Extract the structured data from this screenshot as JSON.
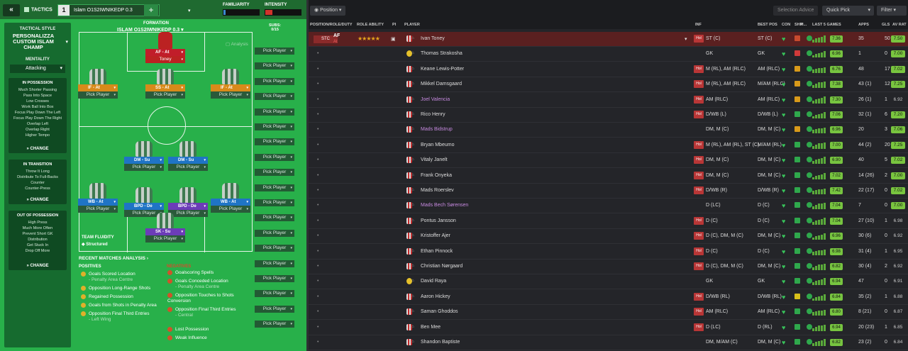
{
  "top": {
    "tab_label": "TACTICS",
    "tab_number": "1",
    "tactic_name": "Islam O1S2IWNIKEDP 0.3",
    "familiarity_label": "FAMILIARITY",
    "intensity_label": "INTENSITY",
    "familiarity_level": 0.05,
    "intensity_level": 0.2
  },
  "sidebar": {
    "style_label": "TACTICAL STYLE",
    "style_name": "PERSONALIZZA CUSTOM ISLAM CHAMP",
    "mentality_label": "MENTALITY",
    "mentality_value": "Attacking",
    "in_possession": {
      "title": "IN POSSESSION",
      "items": [
        "Much Shorter Passing",
        "Pass Into Space",
        "Low Crosses",
        "Work Ball Into Box",
        "Focus Play Down The Left",
        "Focus Play Down The Right",
        "Overlap Left",
        "Overlap Right",
        "Higher Tempo"
      ]
    },
    "in_transition": {
      "title": "IN TRANSITION",
      "items": [
        "Throw It Long",
        "Distribute To Full-Backs",
        "Counter",
        "Counter-Press"
      ]
    },
    "out_of_possession": {
      "title": "OUT OF POSSESSION",
      "items": [
        "High Press",
        "Much More Often",
        "Prevent Short GK",
        "Distribution",
        "Get Stuck In",
        "Drop Off More"
      ]
    },
    "change_label": "CHANGE"
  },
  "formation": {
    "label": "FORMATION",
    "name": "ISLAM O1S2IWNIKEDP 0.3",
    "subs_label": "SUBS:",
    "subs_count": "0/15",
    "analysis_label": "Analysis",
    "pick_label": "Pick Player",
    "fluidity_label": "TEAM FLUIDITY",
    "fluidity_value": "Structured",
    "slots": [
      {
        "role": "AF - At",
        "player": "Toney"
      },
      {
        "role": "IF - At",
        "player": "Pick Player"
      },
      {
        "role": "SS - At",
        "player": "Pick Player"
      },
      {
        "role": "IF - At",
        "player": "Pick Player"
      },
      {
        "role": "DM - Su",
        "player": "Pick Player"
      },
      {
        "role": "DM - Su",
        "player": "Pick Player"
      },
      {
        "role": "WB - At",
        "player": "Pick Player"
      },
      {
        "role": "BPD - De",
        "player": "Pick Player"
      },
      {
        "role": "BPD - De",
        "player": "Pick Player"
      },
      {
        "role": "WB - At",
        "player": "Pick Player"
      },
      {
        "role": "SK - Su",
        "player": "Pick Player"
      }
    ]
  },
  "analysis": {
    "title": "RECENT MATCHES ANALYSIS",
    "positives_label": "POSITIVES",
    "negatives_label": "NEGATIVES",
    "positives": [
      {
        "text": "Goals Scored Location",
        "sub": "- Penalty Area Centre"
      },
      {
        "text": "Opposition Long-Range Shots",
        "sub": ""
      },
      {
        "text": "Regained Possession",
        "sub": ""
      },
      {
        "text": "Goals from Shots in Penalty Area",
        "sub": ""
      },
      {
        "text": "Opposition Final Third Entries",
        "sub": "- Left Wing"
      }
    ],
    "negatives": [
      {
        "text": "Goalscoring Spells",
        "sub": ""
      },
      {
        "text": "Goals Conceded Location",
        "sub": "- Penalty Area Centre"
      },
      {
        "text": "Opposition Touches to Shots Conversion",
        "sub": ""
      },
      {
        "text": "Opposition Final Third Entries",
        "sub": "- Central"
      },
      {
        "text": "Lost Possession",
        "sub": ""
      },
      {
        "text": "Weak Influence",
        "sub": ""
      }
    ]
  },
  "right": {
    "position_btn": "Position",
    "selection_advice": "Selection Advice",
    "quick_pick": "Quick Pick",
    "filter": "Filter",
    "headers": [
      "POSITION/ROLE/DUTY",
      "ROLE ABILITY",
      "PI",
      "PLAYER",
      "INF",
      "BEST POS",
      "CON",
      "SHP",
      "M...",
      "LAST 5 GAMES",
      "APPS",
      "GLS",
      "AV RAT"
    ],
    "selected": {
      "pos": "STC",
      "role": "AF",
      "duty": "At"
    },
    "players": [
      {
        "name": "Ivan Toney",
        "inf": "Hol",
        "pos": "ST (C)",
        "best": "ST (C)",
        "rat": "7.36",
        "apps": "35",
        "gls": "50",
        "av": "7.50",
        "loan": false,
        "gk": false,
        "shp": "#c74a2e"
      },
      {
        "name": "Thomas Strakosha",
        "inf": "",
        "pos": "GK",
        "best": "GK",
        "rat": "6.96",
        "apps": "1",
        "gls": "0",
        "av": "7.00",
        "loan": false,
        "gk": true,
        "shp": "#d03a3a"
      },
      {
        "name": "Keane Lewis-Potter",
        "inf": "Hol",
        "pos": "M (RL), AM (RLC)",
        "best": "AM (RLC)",
        "rat": "6.76",
        "apps": "48",
        "gls": "17",
        "av": "7.02",
        "loan": false,
        "gk": false,
        "shp": "#d89a1a"
      },
      {
        "name": "Mikkel Damsgaard",
        "inf": "Hol",
        "pos": "M (RL), AM (RLC)",
        "best": "M/AM (RLC)",
        "rat": "7.38",
        "apps": "43 (1)",
        "gls": "12",
        "av": "7.25",
        "loan": false,
        "gk": false,
        "shp": "#d89a1a"
      },
      {
        "name": "Joel Valencia",
        "inf": "Hol",
        "pos": "AM (RLC)",
        "best": "AM (RLC)",
        "rat": "7.30",
        "apps": "26 (1)",
        "gls": "1",
        "av": "6.92",
        "loan": true,
        "gk": false,
        "shp": "#d89a1a"
      },
      {
        "name": "Rico Henry",
        "inf": "Hol",
        "pos": "D/WB (L)",
        "best": "D/WB (L)",
        "rat": "7.06",
        "apps": "32 (1)",
        "gls": "6",
        "av": "7.20",
        "loan": false,
        "gk": false,
        "shp": "#2fa84c"
      },
      {
        "name": "Mads Bidstrup",
        "inf": "",
        "pos": "DM, M (C)",
        "best": "DM, M (C)",
        "rat": "6.96",
        "apps": "20",
        "gls": "3",
        "av": "7.06",
        "loan": true,
        "gk": false,
        "shp": "#d89a1a"
      },
      {
        "name": "Bryan Mbeumo",
        "inf": "Hol",
        "pos": "M (RL), AM (RL), ST (C)",
        "best": "M/AM (RL)",
        "rat": "7.00",
        "apps": "44 (2)",
        "gls": "20",
        "av": "7.25",
        "loan": false,
        "gk": false,
        "shp": "#2fa84c"
      },
      {
        "name": "Vitaly Janelt",
        "inf": "Hol",
        "pos": "DM, M (C)",
        "best": "DM, M (C)",
        "rat": "6.90",
        "apps": "40",
        "gls": "5",
        "av": "7.02",
        "loan": false,
        "gk": false,
        "shp": "#2fa84c"
      },
      {
        "name": "Frank Onyeka",
        "inf": "Hol",
        "pos": "DM, M (C)",
        "best": "DM, M (C)",
        "rat": "7.02",
        "apps": "14 (26)",
        "gls": "2",
        "av": "7.00",
        "loan": false,
        "gk": false,
        "shp": "#2fa84c"
      },
      {
        "name": "Mads Roerslev",
        "inf": "Hol",
        "pos": "D/WB (R)",
        "best": "D/WB (R)",
        "rat": "7.42",
        "apps": "22 (17)",
        "gls": "0",
        "av": "7.02",
        "loan": false,
        "gk": false,
        "shp": "#2fa84c"
      },
      {
        "name": "Mads Bech Sørensen",
        "inf": "",
        "pos": "D (LC)",
        "best": "D (C)",
        "rat": "7.04",
        "apps": "7",
        "gls": "0",
        "av": "7.00",
        "loan": true,
        "gk": false,
        "shp": "#2fa84c"
      },
      {
        "name": "Pontus Jansson",
        "inf": "Hol",
        "pos": "D (C)",
        "best": "D (C)",
        "rat": "7.04",
        "apps": "27 (10)",
        "gls": "1",
        "av": "6.98",
        "loan": false,
        "gk": false,
        "shp": "#2fa84c"
      },
      {
        "name": "Kristoffer Ajer",
        "inf": "Hol",
        "pos": "D (C), DM, M (C)",
        "best": "DM, M (C)",
        "rat": "6.96",
        "apps": "30 (6)",
        "gls": "0",
        "av": "6.92",
        "loan": false,
        "gk": false,
        "shp": "#2fa84c"
      },
      {
        "name": "Ethan Pinnock",
        "inf": "Hol",
        "pos": "D (C)",
        "best": "D (C)",
        "rat": "6.98",
        "apps": "31 (4)",
        "gls": "1",
        "av": "6.95",
        "loan": false,
        "gk": false,
        "shp": "#2fa84c"
      },
      {
        "name": "Christian Nørgaard",
        "inf": "Hol",
        "pos": "D (C), DM, M (C)",
        "best": "DM, M (C)",
        "rat": "6.82",
        "apps": "30 (4)",
        "gls": "2",
        "av": "6.92",
        "loan": false,
        "gk": false,
        "shp": "#2fa84c"
      },
      {
        "name": "David Raya",
        "inf": "",
        "pos": "GK",
        "best": "GK",
        "rat": "6.94",
        "apps": "47",
        "gls": "0",
        "av": "6.91",
        "loan": false,
        "gk": true,
        "shp": "#2fa84c"
      },
      {
        "name": "Aaron Hickey",
        "inf": "Hol",
        "pos": "D/WB (RL)",
        "best": "D/WB (RL)",
        "rat": "6.84",
        "apps": "35 (2)",
        "gls": "1",
        "av": "6.88",
        "loan": false,
        "gk": false,
        "shp": "#d8c01a"
      },
      {
        "name": "Saman Ghoddos",
        "inf": "Hol",
        "pos": "AM (RLC)",
        "best": "AM (RLC)",
        "rat": "6.80",
        "apps": "8 (21)",
        "gls": "0",
        "av": "6.87",
        "loan": false,
        "gk": false,
        "shp": "#2fa84c"
      },
      {
        "name": "Ben Mee",
        "inf": "Hol",
        "pos": "D (LC)",
        "best": "D (RL)",
        "rat": "6.94",
        "apps": "20 (23)",
        "gls": "1",
        "av": "6.85",
        "loan": false,
        "gk": false,
        "shp": "#2fa84c"
      },
      {
        "name": "Shandon Baptiste",
        "inf": "",
        "pos": "DM, M/AM (C)",
        "best": "DM, M (C)",
        "rat": "6.82",
        "apps": "23 (2)",
        "gls": "0",
        "av": "6.84",
        "loan": false,
        "gk": false,
        "shp": "#2fa84c"
      }
    ]
  }
}
